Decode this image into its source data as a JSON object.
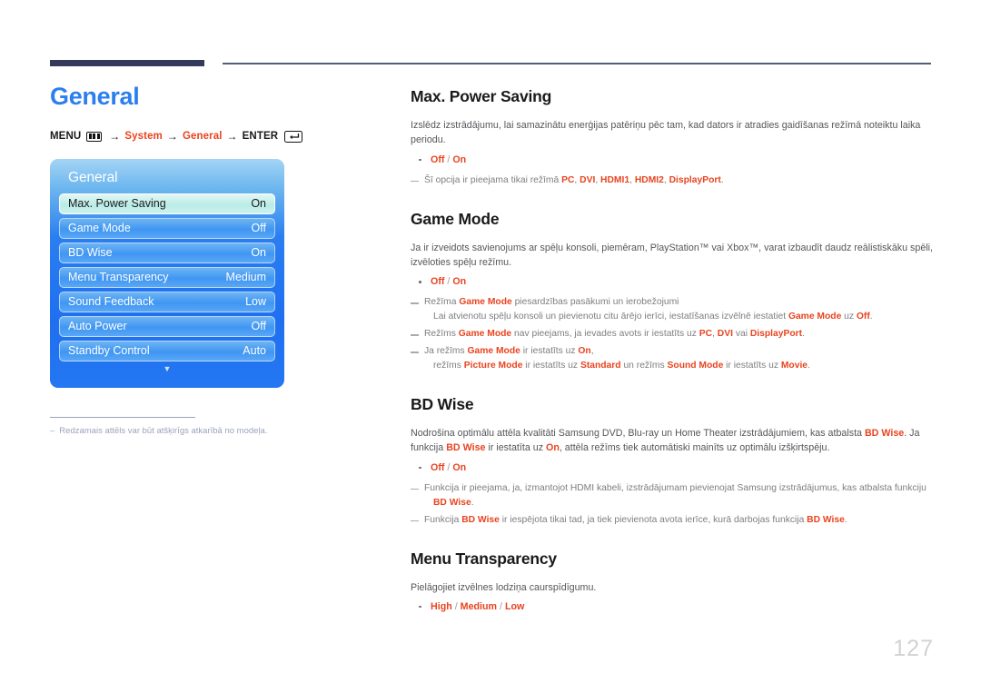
{
  "page": {
    "title": "General",
    "number": "127"
  },
  "breadcrumb": {
    "menu_label": "MENU",
    "menu_icon": "menu-bars-icon",
    "arrow": "→",
    "step1": "System",
    "step2": "General",
    "enter_label": "ENTER",
    "enter_icon": "enter-return-icon"
  },
  "osd": {
    "title": "General",
    "rows": [
      {
        "label": "Max. Power Saving",
        "value": "On",
        "selected": true
      },
      {
        "label": "Game Mode",
        "value": "Off",
        "selected": false
      },
      {
        "label": "BD Wise",
        "value": "On",
        "selected": false
      },
      {
        "label": "Menu Transparency",
        "value": "Medium",
        "selected": false
      },
      {
        "label": "Sound Feedback",
        "value": "Low",
        "selected": false
      },
      {
        "label": "Auto Power",
        "value": "Off",
        "selected": false
      },
      {
        "label": "Standby Control",
        "value": "Auto",
        "selected": false
      }
    ],
    "scroll_more_icon": "chevron-down-icon"
  },
  "panel_note": {
    "dash": "–",
    "text": "Redzamais attēls var būt atšķirīgs atkarībā no modeļa."
  },
  "sections": [
    {
      "heading": "Max. Power Saving",
      "body": "Izslēdz izstrādājumu, lai samazinātu enerģijas patēriņu pēc tam, kad dators ir atradies gaidīšanas režīmā noteiktu laika periodu.",
      "options": [
        "Off",
        "On"
      ],
      "notes": [
        "Šī opcija ir pieejama tikai režīmā PC, DVI, HDMI1, HDMI2, DisplayPort."
      ]
    },
    {
      "heading": "Game Mode",
      "body": "Ja ir izveidots savienojums ar spēļu konsoli, piemēram, PlayStation™ vai Xbox™, varat izbaudīt daudz reālistiskāku spēli, izvēloties spēļu režīmu.",
      "options": [
        "Off",
        "On"
      ],
      "notes": [
        "Režīma Game Mode piesardzības pasākumi un ierobežojumi",
        "Lai atvienotu spēļu konsoli un pievienotu citu ārējo ierīci, iestatīšanas izvēlnē iestatiet Game Mode uz Off.",
        "Režīms Game Mode nav pieejams, ja ievades avots ir iestatīts uz PC, DVI vai DisplayPort.",
        "Ja režīms Game Mode ir iestatīts uz On,",
        "režīms Picture Mode ir iestatīts uz Standard un režīms Sound Mode ir iestatīts uz Movie."
      ]
    },
    {
      "heading": "BD Wise",
      "body": "Nodrošina optimālu attēla kvalitāti Samsung DVD, Blu-ray un Home Theater izstrādājumiem, kas atbalsta BD Wise. Ja funkcija BD Wise ir iestatīta uz On, attēla režīms tiek automātiski mainīts uz optimālu izšķirtspēju.",
      "options": [
        "Off",
        "On"
      ],
      "notes": [
        "Funkcija ir pieejama, ja, izmantojot HDMI kabeli, izstrādājumam pievienojat Samsung izstrādājumus, kas atbalsta funkciju BD Wise.",
        "Funkcija BD Wise ir iespējota tikai tad, ja tiek pievienota avota ierīce, kurā darbojas funkcija BD Wise."
      ]
    },
    {
      "heading": "Menu Transparency",
      "body": "Pielāgojiet izvēlnes lodziņa caurspīdīgumu.",
      "options": [
        "High",
        "Medium",
        "Low"
      ],
      "notes": []
    }
  ],
  "colors": {
    "accent_blue": "#2b7fef",
    "accent_orange": "#e8441f",
    "rule_navy": "#333a5c",
    "osd_blue": "#2a7ff0",
    "page_number_gray": "#d2d2d4"
  }
}
